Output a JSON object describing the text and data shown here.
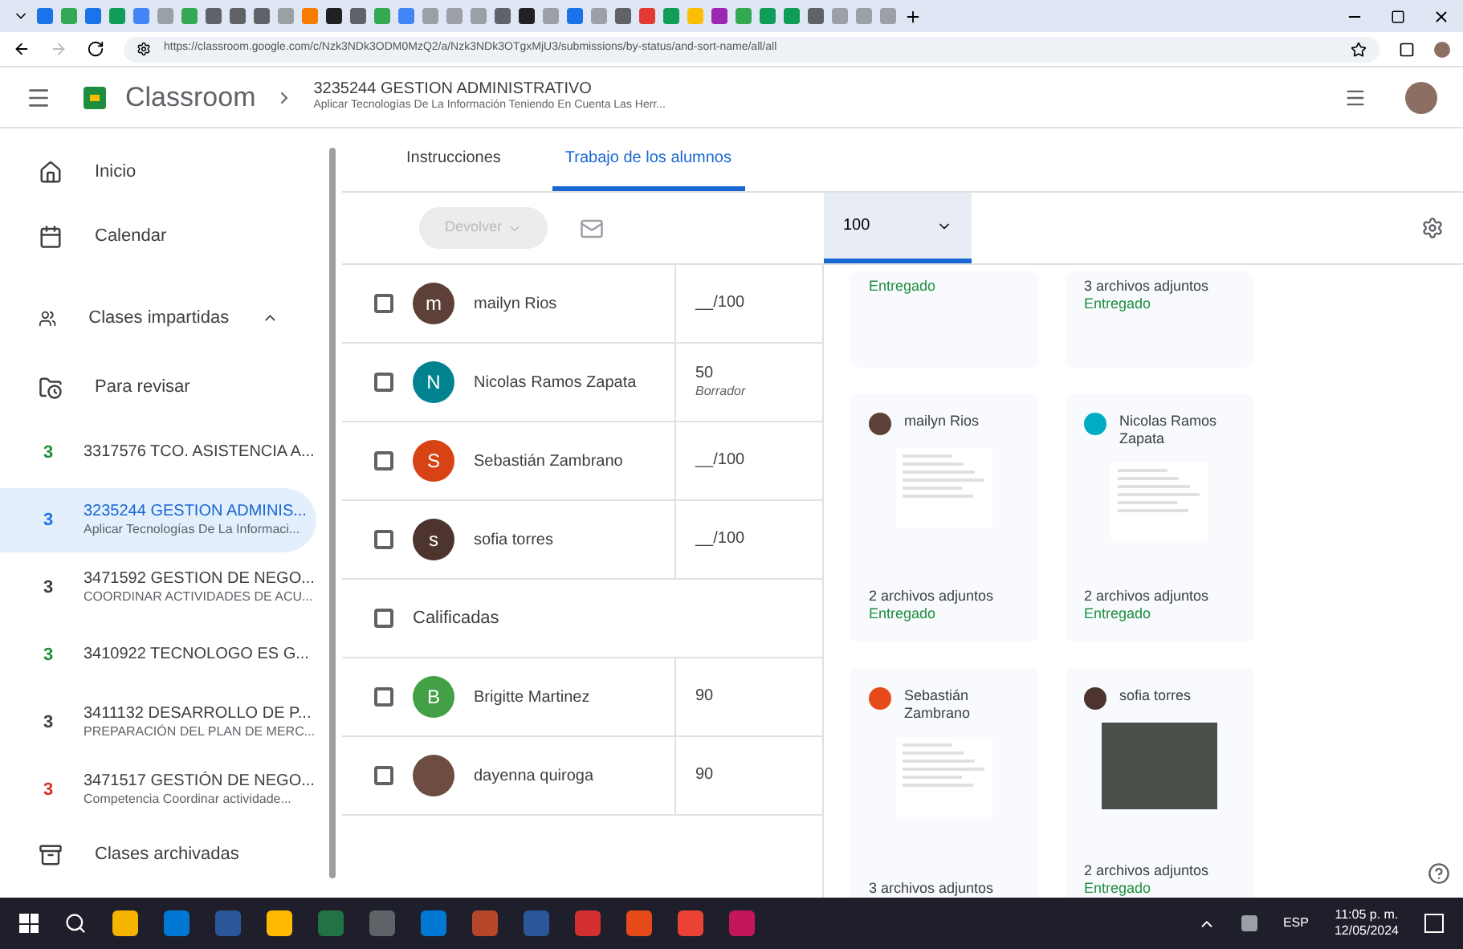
{
  "browser": {
    "url": "https://classroom.google.com/c/Nzk3NDk3ODM0MzQ2/a/Nzk3NDk3OTgxMjU3/submissions/by-status/and-sort-name/all/all"
  },
  "header": {
    "app_name": "Classroom",
    "class_title": "3235244 GESTION ADMINISTRATIVO",
    "class_subtitle": "Aplicar Tecnologías De La Información Teniendo En Cuenta Las Herr..."
  },
  "sidebar": {
    "items": [
      {
        "kind": "nav",
        "label": "Inicio"
      },
      {
        "kind": "nav",
        "label": "Calendar"
      },
      {
        "kind": "section",
        "label": "Clases impartidas",
        "expanded": true
      },
      {
        "kind": "nav",
        "label": "Para revisar"
      },
      {
        "kind": "class",
        "badge": "3",
        "color": "#1e8e3e",
        "label": "3317576 TCO. ASISTENCIA A...",
        "selected": false
      },
      {
        "kind": "class",
        "badge": "3",
        "color": "#1a73e8",
        "label": "3235244 GESTION ADMINIS...",
        "sub": "Aplicar Tecnologías De La Informaci...",
        "selected": true
      },
      {
        "kind": "class",
        "badge": "3",
        "color": "#3c4043",
        "label": "3471592 GESTION DE NEGO...",
        "sub": "COORDINAR ACTIVIDADES DE ACU...",
        "selected": false
      },
      {
        "kind": "class",
        "badge": "3",
        "color": "#1e8e3e",
        "label": "3410922 TECNOLOGO ES G...",
        "selected": false
      },
      {
        "kind": "class",
        "badge": "3",
        "color": "#3c4043",
        "label": "3411132 DESARROLLO DE P...",
        "sub": "PREPARACIÓN DEL PLAN DE MERC...",
        "selected": false
      },
      {
        "kind": "class",
        "badge": "3",
        "color": "#d93025",
        "label": "3471517 GESTIÓN DE NEGO...",
        "sub": "Competencia Coordinar actividade...",
        "selected": false
      }
    ],
    "footer": "Clases archivadas"
  },
  "tabs": [
    {
      "label": "Instrucciones",
      "selected": false
    },
    {
      "label": "Trabajo de los alumnos",
      "selected": true
    }
  ],
  "toolbar": {
    "return_button": "Devolver",
    "points": "100"
  },
  "students": [
    {
      "kind": "student",
      "name": "mailyn Rios",
      "initial": "m",
      "color": "#5d4037",
      "grade": "__/100",
      "checked": false
    },
    {
      "kind": "student",
      "name": "Nicolas Ramos Zapata",
      "initial": "N",
      "color": "#00838f",
      "grade": "50",
      "grade_note": "Borrador",
      "checked": false
    },
    {
      "kind": "student",
      "name": "Sebastián Zambrano",
      "initial": "S",
      "color": "#d84315",
      "grade": "__/100",
      "checked": false
    },
    {
      "kind": "student",
      "name": "sofia torres",
      "initial": "s",
      "color": "#4e342e",
      "grade": "__/100",
      "checked": false
    },
    {
      "kind": "group",
      "name": "Calificadas",
      "checked": false
    },
    {
      "kind": "student",
      "name": "Brigitte Martinez",
      "initial": "B",
      "color": "#43a047",
      "grade": "90",
      "checked": false
    },
    {
      "kind": "photo",
      "name": "dayenna quiroga",
      "grade": "90",
      "checked": false
    }
  ],
  "cards": [
    {
      "kind": "cut",
      "status": "Entregado"
    },
    {
      "kind": "cut",
      "attachments": "3 archivos adjuntos",
      "status": "Entregado"
    },
    {
      "kind": "document",
      "name": "mailyn Rios",
      "color": "#5d4037",
      "attachments": "2 archivos adjuntos",
      "status": "Entregado"
    },
    {
      "kind": "document",
      "name": "Nicolas Ramos Zapata",
      "color": "#00acc1",
      "attachments": "2 archivos adjuntos",
      "status": "Entregado"
    },
    {
      "kind": "document",
      "name": "Sebastián Zambrano",
      "color": "#e64a19",
      "attachments": "3 archivos adjuntos"
    },
    {
      "kind": "photo",
      "name": "sofia torres",
      "color": "#4e342e",
      "attachments": "2 archivos adjuntos",
      "status": "Entregado"
    }
  ],
  "taskbar": {
    "language": "ESP",
    "time": "11:05 p. m.",
    "date": "12/05/2024"
  }
}
